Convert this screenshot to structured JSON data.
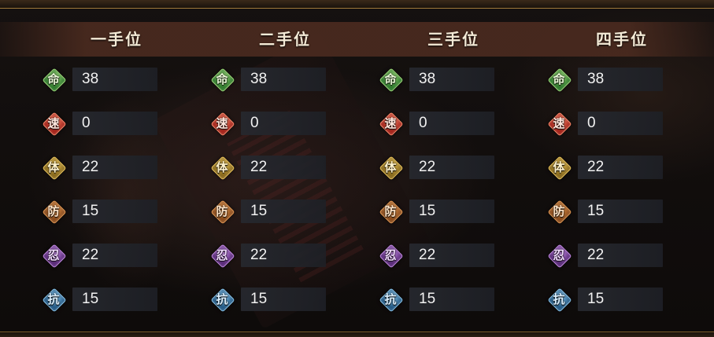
{
  "stat_icons": [
    {
      "glyph": "命",
      "icon": "life-icon",
      "fill": "#2f7a2c",
      "edge": "#9fdc7a",
      "glyph_color": "#e8f7d6"
    },
    {
      "glyph": "速",
      "icon": "speed-icon",
      "fill": "#a5231a",
      "edge": "#ff8a6a",
      "glyph_color": "#ffe6dc"
    },
    {
      "glyph": "体",
      "icon": "constitution-icon",
      "fill": "#8a6a1c",
      "edge": "#f0c85a",
      "glyph_color": "#fff2cc"
    },
    {
      "glyph": "防",
      "icon": "defense-icon",
      "fill": "#8a4a1a",
      "edge": "#e79a52",
      "glyph_color": "#ffe4c8"
    },
    {
      "glyph": "忍",
      "icon": "endurance-icon",
      "fill": "#5a2a7a",
      "edge": "#c68ae8",
      "glyph_color": "#f2dcff"
    },
    {
      "glyph": "抗",
      "icon": "resist-icon",
      "fill": "#245a86",
      "edge": "#8ac8f0",
      "glyph_color": "#dcf0ff"
    }
  ],
  "columns": [
    {
      "title": "一手位",
      "values": [
        "38",
        "0",
        "22",
        "15",
        "22",
        "15"
      ]
    },
    {
      "title": "二手位",
      "values": [
        "38",
        "0",
        "22",
        "15",
        "22",
        "15"
      ]
    },
    {
      "title": "三手位",
      "values": [
        "38",
        "0",
        "22",
        "15",
        "22",
        "15"
      ]
    },
    {
      "title": "四手位",
      "values": [
        "38",
        "0",
        "22",
        "15",
        "22",
        "15"
      ]
    }
  ]
}
